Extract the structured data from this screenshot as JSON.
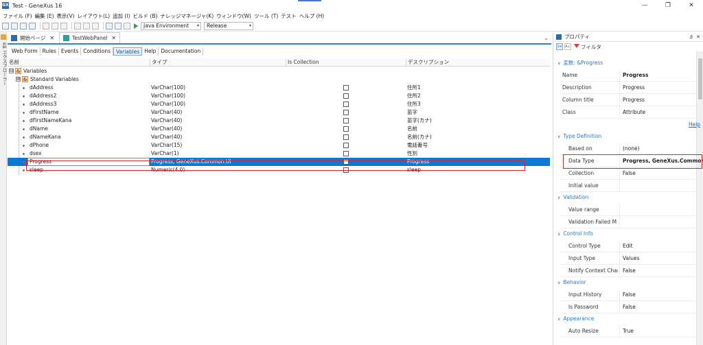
{
  "window": {
    "title": "Test - GeneXus 16",
    "app_icon": "GX",
    "controls": [
      "—",
      "❐",
      "✕"
    ]
  },
  "menu": [
    "ファイル (F)",
    "編集 (E)",
    "表示(V)",
    "レイアウト(L)",
    "追加 (I)",
    "ビルド (B)",
    "ナレッジマネージャ(K)",
    "ウィンドウ(W)",
    "ツール (T)",
    "テスト",
    "ヘルプ (H)"
  ],
  "toolbar": {
    "environment": "Java Environment",
    "configuration": "Release"
  },
  "left_strip": {
    "label": "KB エクスプローラー"
  },
  "doc_tabs": [
    {
      "label": "開始ページ",
      "close": "✕"
    },
    {
      "label": "TestWebPanel",
      "close": "✕"
    }
  ],
  "sub_tabs": [
    "Web Form",
    "Rules",
    "Events",
    "Conditions",
    "Variables",
    "Help",
    "Documentation"
  ],
  "grid": {
    "headers": [
      "名前",
      "タイプ",
      "Is Collection",
      "デスクリプション"
    ],
    "root": {
      "label": "Variables",
      "expander": "⊟"
    },
    "standard": {
      "label": "Standard Variables",
      "expander": "⊞"
    },
    "rows": [
      {
        "name": "dAddress",
        "type": "VarChar(100)",
        "desc": "住所1"
      },
      {
        "name": "dAddress2",
        "type": "VarChar(100)",
        "desc": "住所2"
      },
      {
        "name": "dAddress3",
        "type": "VarChar(100)",
        "desc": "住所3"
      },
      {
        "name": "dFirstName",
        "type": "VarChar(40)",
        "desc": "苗字"
      },
      {
        "name": "dFirstNameKana",
        "type": "VarChar(40)",
        "desc": "苗字(カナ)"
      },
      {
        "name": "dName",
        "type": "VarChar(40)",
        "desc": "名前"
      },
      {
        "name": "dNameKana",
        "type": "VarChar(40)",
        "desc": "名前(カナ)"
      },
      {
        "name": "dPhone",
        "type": "VarChar(15)",
        "desc": "電話番号"
      },
      {
        "name": "dsex",
        "type": "VarChar(1)",
        "desc": "性別"
      },
      {
        "name": "Progress",
        "type": "Progress, GeneXus.Common.UI",
        "desc": "Progress"
      },
      {
        "name": "sleep",
        "type": "Numeric(4.0)",
        "desc": "sleep"
      }
    ]
  },
  "props": {
    "title": "プロパティ",
    "pin": "⊅",
    "close": "✕",
    "sort_btn_a": "1≡",
    "sort_btn_b": "A↓",
    "filter_label": "フィルタ",
    "var_section": "変数: &Progress",
    "general": [
      {
        "k": "Name",
        "v": "Progress",
        "bold": true
      },
      {
        "k": "Description",
        "v": "Progress"
      },
      {
        "k": "Column title",
        "v": "Progress"
      },
      {
        "k": "Class",
        "v": "Attribute"
      }
    ],
    "help": "Help",
    "type_def": {
      "label": "Type Definition",
      "rows": [
        {
          "k": "Based on",
          "v": "(none)"
        },
        {
          "k": "Data Type",
          "v": "Progress, GeneXus.Common.UI",
          "bold": true
        },
        {
          "k": "Collection",
          "v": "False"
        },
        {
          "k": "Initial value",
          "v": ""
        }
      ]
    },
    "validation": {
      "label": "Validation",
      "rows": [
        {
          "k": "Value range",
          "v": ""
        },
        {
          "k": "Validation Failed M",
          "v": ""
        }
      ]
    },
    "control_info": {
      "label": "Control Info",
      "rows": [
        {
          "k": "Control Type",
          "v": "Edit"
        },
        {
          "k": "Input Type",
          "v": "Values"
        },
        {
          "k": "Notify Context Char",
          "v": "False"
        }
      ]
    },
    "behavior": {
      "label": "Behavior",
      "rows": [
        {
          "k": "Input History",
          "v": "False"
        },
        {
          "k": "Is Password",
          "v": "False"
        }
      ]
    },
    "appearance": {
      "label": "Appearance",
      "rows": [
        {
          "k": "Auto Resize",
          "v": "True"
        }
      ]
    }
  },
  "colors": {
    "selection": "#0b78d4",
    "highlight_box": "#d6262b",
    "section_text": "#2b79c2"
  }
}
